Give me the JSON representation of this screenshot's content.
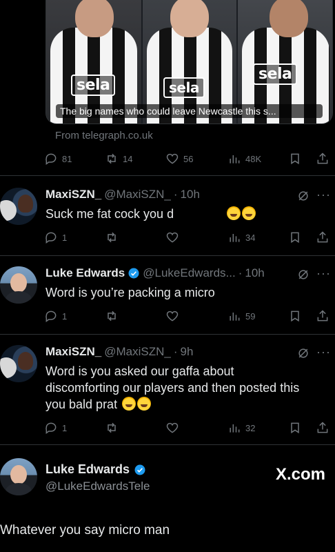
{
  "card": {
    "caption": "The big names who could leave Newcastle this s...",
    "sponsor": "sela",
    "source": "From telegraph.co.uk"
  },
  "main_actions": {
    "replies": "81",
    "reposts": "14",
    "likes": "56",
    "views": "48K"
  },
  "tweets": [
    {
      "name": "MaxiSZN_",
      "handle": "@MaxiSZN_",
      "time": "10h",
      "text": "Suck me fat cock you d",
      "emoji_count": 2,
      "replies": "1",
      "views": "34"
    },
    {
      "name": "Luke Edwards",
      "handle": "@LukeEdwards...",
      "time": "10h",
      "verified": true,
      "text": "Word is you’re packing a micro",
      "replies": "1",
      "views": "59"
    },
    {
      "name": "MaxiSZN_",
      "handle": "@MaxiSZN_",
      "time": "9h",
      "text": "Word is you asked our gaffa about discomforting our players and then posted this you bald prat",
      "emoji_count": 2,
      "replies": "1",
      "views": "32"
    }
  ],
  "quote_card": {
    "name": "Luke Edwards",
    "handle": "@LukeEdwardsTele",
    "watermark": "X.com"
  },
  "caption": "Whatever you say micro man",
  "colors": {
    "background": "#000000",
    "text": "#e7e9ea",
    "muted": "#71767b",
    "verified": "#1d9bf0"
  },
  "icons": [
    "reply-icon",
    "repost-icon",
    "like-icon",
    "views-icon",
    "bookmark-icon",
    "share-icon",
    "verified-icon",
    "grok-icon",
    "more-icon"
  ]
}
